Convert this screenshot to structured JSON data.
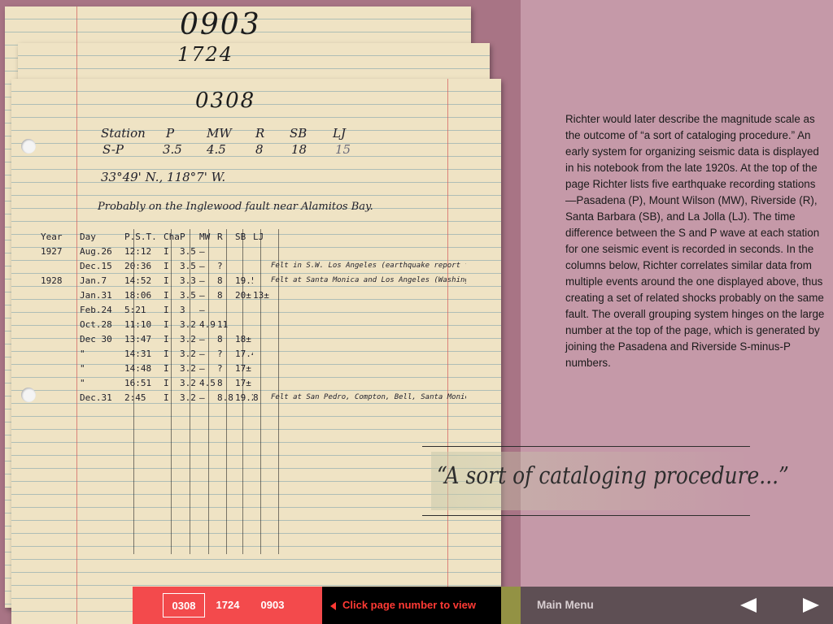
{
  "notebook": {
    "back_page_1_number": "0903",
    "back_page_2_number": "1724",
    "front_page_number": "0308",
    "stations_header": [
      "Station",
      "P",
      "MW",
      "R",
      "SB",
      "LJ"
    ],
    "sp_row": [
      "S-P",
      "3.5",
      "4.5",
      "8",
      "18",
      "15"
    ],
    "coordinates": "33°49' N., 118°7' W.",
    "fault_note": "Probably on the Inglewood fault near Alamitos Bay.",
    "ledger_header": [
      "Year",
      "Day",
      "P.S.T.",
      "Char",
      "P",
      "MW",
      "R",
      "SB",
      "LJ",
      ""
    ],
    "ledger_rows": [
      [
        "1927",
        "Aug.26",
        "12:12",
        "I",
        "3.5",
        "—",
        "",
        "",
        "",
        ""
      ],
      [
        "",
        "Dec.15",
        "20:36",
        "I",
        "3.5",
        "—",
        "?",
        "",
        "",
        "Felt in S.W. Los Angeles (earthquake report form)"
      ],
      [
        "1928",
        "Jan.7",
        "14:52",
        "I",
        "3.3",
        "—",
        "8",
        "19.5",
        "",
        "Felt at Santa Monica and Los Angeles (Washington dispatch)"
      ],
      [
        "",
        "Jan.31",
        "18:06",
        "I",
        "3.5",
        "—",
        "8",
        "20±",
        "13±",
        ""
      ],
      [
        "",
        "Feb.24",
        "5:21",
        "I",
        "3",
        "—",
        "",
        "",
        "",
        ""
      ],
      [
        "",
        "Oct.28",
        "11:10",
        "I",
        "3.2",
        "4.9",
        "11",
        "",
        "",
        ""
      ],
      [
        "",
        "Dec 30",
        "13:47",
        "I",
        "3.2",
        "—",
        "8",
        "18±",
        "",
        ""
      ],
      [
        "",
        "\"",
        "14:31",
        "I",
        "3.2",
        "—",
        "?",
        "17.4±",
        "",
        ""
      ],
      [
        "",
        "\"",
        "14:48",
        "I",
        "3.2",
        "—",
        "?",
        "17±",
        "",
        ""
      ],
      [
        "",
        "\"",
        "16:51",
        "I",
        "3.2",
        "4.5",
        "8",
        "17±",
        "",
        ""
      ],
      [
        "",
        "Dec.31",
        "2:45",
        "I",
        "3.2",
        "—",
        "8.8",
        "19.2",
        "8",
        "Felt at San Pedro, Compton, Bell, Santa Monica, etc."
      ]
    ]
  },
  "description": "Richter would later describe the magnitude scale as the outcome of “a sort of cataloging procedure.” An early system for organizing seismic data is displayed in his notebook from the late 1920s. At the top of the page Richter lists five earthquake recording stations—Pasadena (P), Mount Wilson (MW), Riverside (R), Santa Barbara (SB), and La Jolla (LJ). The time difference between the S and P wave at each station for one seismic event is recorded in seconds. In the columns below, Richter correlates similar data from multiple events around the one displayed above, thus creating a set of related shocks probably on the same fault. The overall grouping system hinges on the large number at the top of the page, which is generated by joining the Pasadena and Riverside S-minus-P numbers.",
  "quote": "“A sort of cataloging procedure...”",
  "bottom_bar": {
    "pages": [
      "0308",
      "1724",
      "0903"
    ],
    "active_page": "0308",
    "hint": "Click page number to view",
    "main_menu": "Main Menu",
    "prev_icon": "triangle-left-icon",
    "next_icon": "triangle-right-icon"
  },
  "colors": {
    "pager_bg": "#f34a4c",
    "hint_text": "#ff3a34",
    "nav_bg": "#5e4f54",
    "panel_bg": "#c599a8"
  }
}
